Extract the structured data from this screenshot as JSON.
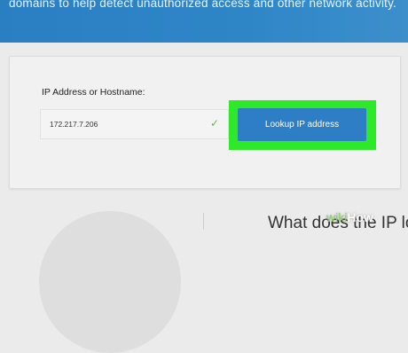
{
  "banner": {
    "text": "domains to help detect unauthorized access and other network activity."
  },
  "lookup": {
    "label": "IP Address or Hostname:",
    "input_value": "172.217.7.206",
    "check_icon": "checkmark-icon",
    "button_label": "Lookup IP address"
  },
  "section": {
    "heading": "What does the IP lo"
  },
  "watermark": {
    "wiki": "wiki",
    "how": "How"
  },
  "colors": {
    "banner": "#2f86c7",
    "button": "#2d7ec4",
    "highlight": "#2ee82a",
    "check": "#5fba4a"
  }
}
